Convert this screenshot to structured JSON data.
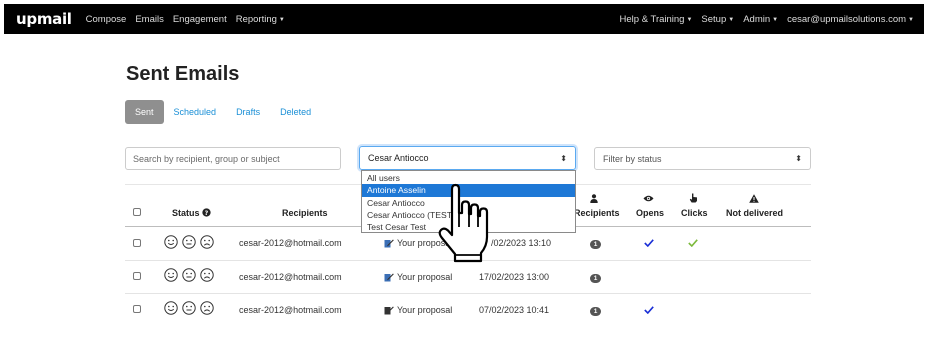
{
  "navbar": {
    "brand": "upmail",
    "left_items": [
      "Compose",
      "Emails",
      "Engagement",
      "Reporting"
    ],
    "right_items": [
      "Help & Training",
      "Setup",
      "Admin",
      "cesar@upmailsolutions.com"
    ]
  },
  "page": {
    "title": "Sent Emails"
  },
  "tabs": [
    "Sent",
    "Scheduled",
    "Drafts",
    "Deleted"
  ],
  "filters": {
    "search_placeholder": "Search by recipient, group or subject",
    "user_selected": "Cesar Antiocco",
    "user_options": [
      "All users",
      "Antoine Asselin",
      "Cesar Antiocco",
      "Cesar Antiocco (TEST)",
      "Test Cesar Test"
    ],
    "highlighted_option": "Antoine Asselin",
    "status_placeholder": "Filter by status"
  },
  "table": {
    "headers": {
      "status": "Status",
      "recipients": "Recipients",
      "recipients_count": "Recipients",
      "opens": "Opens",
      "clicks": "Clicks",
      "not_delivered": "Not delivered"
    },
    "rows": [
      {
        "email": "cesar-2012@hotmail.com",
        "subject": "Your proposal",
        "date": "/02/2023 13:10",
        "count": "1",
        "opened": true,
        "clicked": true
      },
      {
        "email": "cesar-2012@hotmail.com",
        "subject": "Your proposal",
        "date": "17/02/2023 13:00",
        "count": "1",
        "opened": false,
        "clicked": false
      },
      {
        "email": "cesar-2012@hotmail.com",
        "subject": "Your proposal",
        "date": "07/02/2023 10:41",
        "count": "1",
        "opened": true,
        "clicked": false
      }
    ]
  },
  "colors": {
    "navbar_bg": "#000000",
    "link": "#1a8fd6",
    "active_tab": "#8f8f8f",
    "highlight": "#1e78d6",
    "open_check": "#1a2fd6",
    "click_check": "#7cba3c"
  },
  "icons": {
    "header_status": "question-circle-icon",
    "header_recipients": "user-icon",
    "header_opens": "eye-icon",
    "header_clicks": "pointer-hand-icon",
    "header_not_delivered": "warning-icon",
    "faces": [
      "smile-icon",
      "neutral-face-icon",
      "frown-face-icon"
    ],
    "subject": "edit-document-icon",
    "cursor": "hand-cursor-icon"
  }
}
